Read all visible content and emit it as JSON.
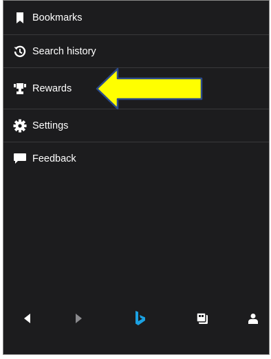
{
  "menu": {
    "items": [
      {
        "id": "bookmarks",
        "label": "Bookmarks",
        "icon": "bookmark-icon"
      },
      {
        "id": "search-history",
        "label": "Search history",
        "icon": "history-icon"
      },
      {
        "id": "rewards",
        "label": "Rewards",
        "icon": "trophy-icon"
      },
      {
        "id": "settings",
        "label": "Settings",
        "icon": "gear-icon"
      },
      {
        "id": "feedback",
        "label": "Feedback",
        "icon": "chat-bubble-icon"
      }
    ]
  },
  "bottom_nav": {
    "back_icon": "back-triangle-icon",
    "forward_icon": "forward-triangle-icon",
    "home_icon": "bing-logo-icon",
    "tabs_icon": "tabs-icon",
    "profile_icon": "person-icon"
  },
  "colors": {
    "background": "#1c1c1e",
    "text": "#ffffff",
    "divider": "#3a3a3c",
    "bing_blue": "#1ba1e2",
    "annotation_arrow": "#ffff00"
  }
}
